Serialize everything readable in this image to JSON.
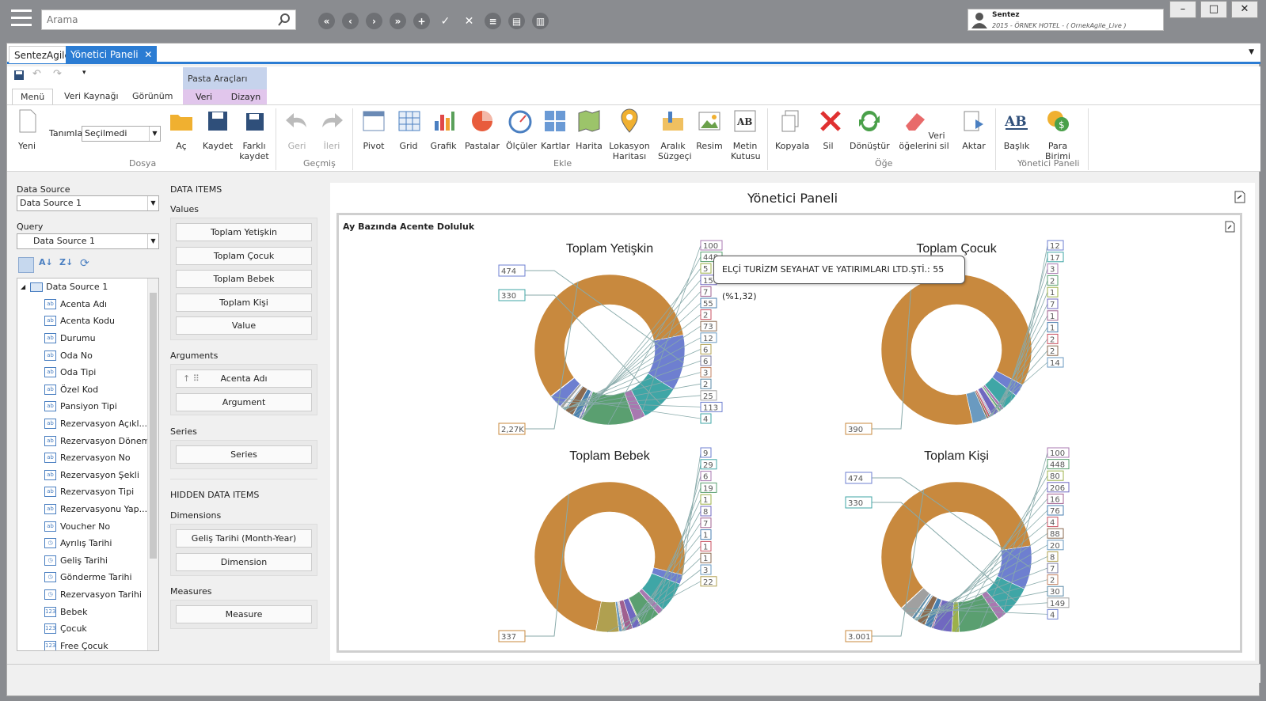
{
  "topbar": {
    "search_placeholder": "Arama",
    "user_name": "Sentez",
    "user_detail": "2015 - ÖRNEK HOTEL - ( OrnekAgile_Live )"
  },
  "tabs": {
    "first": "SentezAgile",
    "active": "Yönetici Paneli"
  },
  "ribbon": {
    "tabs": [
      "Menü",
      "Veri Kaynağı",
      "Görünüm"
    ],
    "context_group": "Pasta Araçları",
    "context_tabs": [
      "Veri",
      "Dizayn"
    ],
    "definitions_label": "Tanımlar",
    "definitions_value": "Seçilmedi",
    "buttons": {
      "new": "Yeni",
      "open": "Aç",
      "save": "Kaydet",
      "save_as": "Farklı kaydet",
      "back": "Geri",
      "forward": "İleri",
      "pivot": "Pivot",
      "grid": "Grid",
      "chart": "Grafik",
      "pies": "Pastalar",
      "gauges": "Ölçüler",
      "cards": "Kartlar",
      "map": "Harita",
      "location_map": "Lokasyon Haritası",
      "range_filter": "Aralık Süzgeçi",
      "image": "Resim",
      "textbox": "Metin Kutusu",
      "copy": "Kopyala",
      "delete": "Sil",
      "convert": "Dönüştür",
      "clear_data_items": "Veri öğelerini sil",
      "transfer": "Aktar",
      "title": "Başlık",
      "currency": "Para Birimi"
    },
    "groups": {
      "file": "Dosya",
      "history": "Geçmiş",
      "insert": "Ekle",
      "item": "Öğe",
      "dashboard": "Yönetici Paneli"
    }
  },
  "left": {
    "data_source_label": "Data Source",
    "data_source_value": "Data Source 1",
    "query_label": "Query",
    "query_value": "Data Source 1",
    "tree_root": "Data Source 1",
    "fields": [
      [
        "ab",
        "Acenta Adı"
      ],
      [
        "ab",
        "Acenta Kodu"
      ],
      [
        "ab",
        "Durumu"
      ],
      [
        "ab",
        "Oda No"
      ],
      [
        "ab",
        "Oda Tipi"
      ],
      [
        "ab",
        "Özel Kod"
      ],
      [
        "ab",
        "Pansiyon Tipi"
      ],
      [
        "ab",
        "Rezervasyon Açıkl..."
      ],
      [
        "ab",
        "Rezervasyon Dönemi"
      ],
      [
        "ab",
        "Rezervasyon No"
      ],
      [
        "ab",
        "Rezervasyon Şekli"
      ],
      [
        "ab",
        "Rezervasyon Tipi"
      ],
      [
        "ab",
        "Rezervasyonu Yap..."
      ],
      [
        "ab",
        "Voucher No"
      ],
      [
        "clk",
        "Ayrılış Tarihi"
      ],
      [
        "clk",
        "Geliş Tarihi"
      ],
      [
        "clk",
        "Gönderme Tarihi"
      ],
      [
        "clk",
        "Rezervasyon Tarihi"
      ],
      [
        "123",
        "Bebek"
      ],
      [
        "123",
        "Çocuk"
      ],
      [
        "123",
        "Free Çocuk"
      ]
    ]
  },
  "mid": {
    "data_items": "DATA ITEMS",
    "values_label": "Values",
    "values": [
      "Toplam Yetişkin",
      "Toplam Çocuk",
      "Toplam Bebek",
      "Toplam Kişi",
      "Value"
    ],
    "arguments_label": "Arguments",
    "arguments": [
      "Acenta Adı",
      "Argument"
    ],
    "series_label": "Series",
    "series": [
      "Series"
    ],
    "hidden": "HIDDEN DATA ITEMS",
    "dimensions_label": "Dimensions",
    "dimensions": [
      "Geliş Tarihi (Month-Year)",
      "Dimension"
    ],
    "measures_label": "Measures",
    "measures": [
      "Measure"
    ]
  },
  "dashboard": {
    "title": "Yönetici Paneli",
    "panel_title": "Ay Bazında Acente Doluluk",
    "tooltip": "ELÇİ TURİZM SEYAHAT VE YATIRIMLARI LTD.ŞTİ.: 55 (%1,32)"
  },
  "chart_data": [
    {
      "type": "pie",
      "title": "Toplam Yetişkin",
      "left_labels": [
        "474",
        "330",
        "2,27K"
      ],
      "right_labels": [
        "100",
        "448",
        "5",
        "15",
        "7",
        "55",
        "2",
        "73",
        "12",
        "6",
        "6",
        "3",
        "2",
        "25",
        "113",
        "4"
      ]
    },
    {
      "type": "pie",
      "title": "Toplam Çocuk",
      "left_labels": [
        "390"
      ],
      "right_labels": [
        "12",
        "17",
        "3",
        "2",
        "1",
        "7",
        "1",
        "1",
        "2",
        "2",
        "14"
      ]
    },
    {
      "type": "pie",
      "title": "Toplam Bebek",
      "left_labels": [
        "337"
      ],
      "right_labels": [
        "9",
        "29",
        "6",
        "19",
        "1",
        "8",
        "7",
        "1",
        "1",
        "1",
        "3",
        "22"
      ]
    },
    {
      "type": "pie",
      "title": "Toplam Kişi",
      "left_labels": [
        "474",
        "330",
        "3.001"
      ],
      "right_labels": [
        "100",
        "448",
        "80",
        "206",
        "16",
        "76",
        "4",
        "88",
        "20",
        "8",
        "7",
        "2",
        "30",
        "149",
        "4"
      ]
    }
  ]
}
